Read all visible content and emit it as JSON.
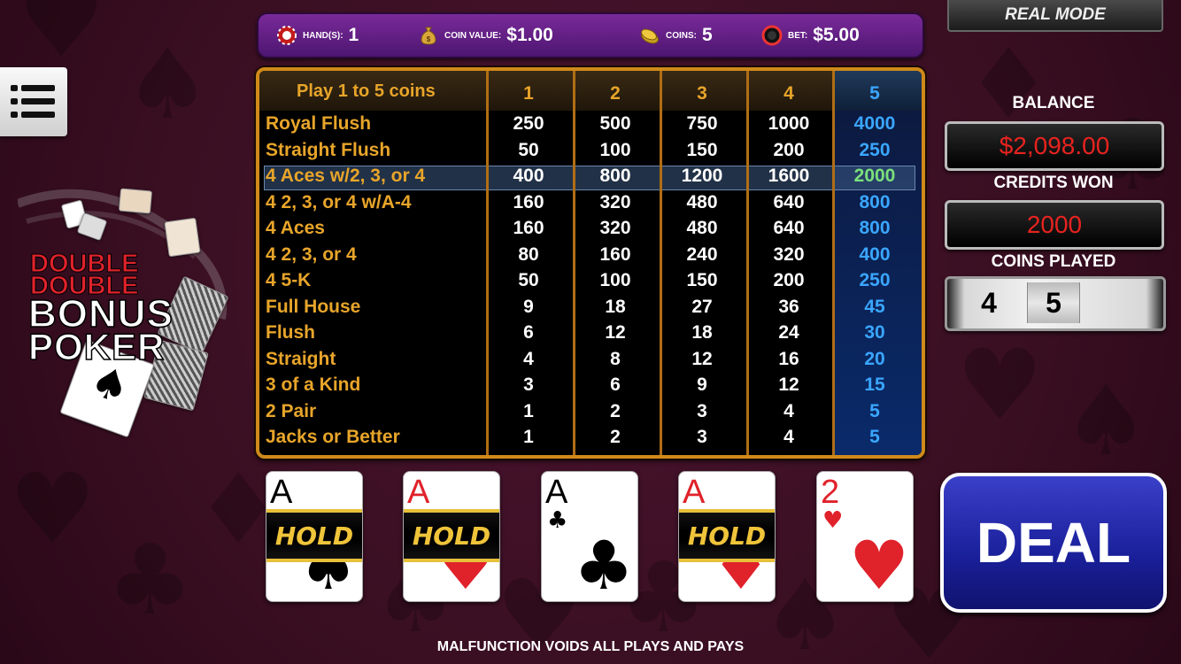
{
  "topbar": {
    "hands_label": "HAND(S):",
    "hands_value": "1",
    "coin_value_label": "COIN VALUE:",
    "coin_value": "$1.00",
    "coins_label": "COINS:",
    "coins_value": "5",
    "bet_label": "BET:",
    "bet_value": "$5.00"
  },
  "mode_button": "REAL MODE",
  "logo": {
    "line1": "DOUBLE",
    "line2": "DOUBLE",
    "line3": "BONUS",
    "line4": "POKER"
  },
  "paytable": {
    "header_label": "Play 1 to 5 coins",
    "coin_headers": [
      "1",
      "2",
      "3",
      "4",
      "5"
    ],
    "highlighted_row": 2,
    "rows": [
      {
        "hand": "Royal Flush",
        "pays": [
          "250",
          "500",
          "750",
          "1000",
          "4000"
        ]
      },
      {
        "hand": "Straight Flush",
        "pays": [
          "50",
          "100",
          "150",
          "200",
          "250"
        ]
      },
      {
        "hand": "4 Aces w/2, 3, or 4",
        "pays": [
          "400",
          "800",
          "1200",
          "1600",
          "2000"
        ]
      },
      {
        "hand": "4 2, 3, or 4 w/A-4",
        "pays": [
          "160",
          "320",
          "480",
          "640",
          "800"
        ]
      },
      {
        "hand": "4 Aces",
        "pays": [
          "160",
          "320",
          "480",
          "640",
          "800"
        ]
      },
      {
        "hand": "4 2, 3, or 4",
        "pays": [
          "80",
          "160",
          "240",
          "320",
          "400"
        ]
      },
      {
        "hand": "4 5-K",
        "pays": [
          "50",
          "100",
          "150",
          "200",
          "250"
        ]
      },
      {
        "hand": "Full House",
        "pays": [
          "9",
          "18",
          "27",
          "36",
          "45"
        ]
      },
      {
        "hand": "Flush",
        "pays": [
          "6",
          "12",
          "18",
          "24",
          "30"
        ]
      },
      {
        "hand": "Straight",
        "pays": [
          "4",
          "8",
          "12",
          "16",
          "20"
        ]
      },
      {
        "hand": "3 of a Kind",
        "pays": [
          "3",
          "6",
          "9",
          "12",
          "15"
        ]
      },
      {
        "hand": "2 Pair",
        "pays": [
          "1",
          "2",
          "3",
          "4",
          "5"
        ]
      },
      {
        "hand": "Jacks or Better",
        "pays": [
          "1",
          "2",
          "3",
          "4",
          "5"
        ]
      }
    ]
  },
  "right_panel": {
    "balance_label": "BALANCE",
    "balance_value": "$2,098.00",
    "credits_won_label": "CREDITS WON",
    "credits_won_value": "2000",
    "coins_played_label": "COINS PLAYED",
    "coins_played_values": [
      "4",
      "5"
    ]
  },
  "cards": [
    {
      "rank": "A",
      "suit": "♠",
      "color": "#000000",
      "held": true
    },
    {
      "rank": "A",
      "suit": "♥",
      "color": "#e0222b",
      "held": true
    },
    {
      "rank": "A",
      "suit": "♣",
      "color": "#000000",
      "held": false
    },
    {
      "rank": "A",
      "suit": "♦",
      "color": "#e0222b",
      "held": true
    },
    {
      "rank": "2",
      "suit": "♥",
      "color": "#e0222b",
      "held": false
    }
  ],
  "hold_label": "HOLD",
  "deal_button": "DEAL",
  "footer": "MALFUNCTION VOIDS ALL PLAYS AND PAYS",
  "colors": {
    "hand_name": "#e8a52a",
    "pay_value": "#ffffff",
    "pay_col5": "#3aa6ff",
    "highlight_col5": "#7be07b",
    "accent_red": "#e8231f"
  }
}
